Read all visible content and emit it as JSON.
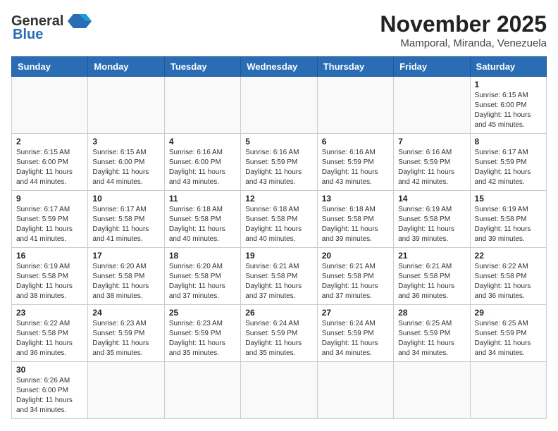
{
  "header": {
    "logo_general": "General",
    "logo_blue": "Blue",
    "month_title": "November 2025",
    "location": "Mamporal, Miranda, Venezuela"
  },
  "days_of_week": [
    "Sunday",
    "Monday",
    "Tuesday",
    "Wednesday",
    "Thursday",
    "Friday",
    "Saturday"
  ],
  "weeks": [
    {
      "days": [
        {
          "number": "",
          "sunrise": "",
          "sunset": "",
          "daylight": "",
          "empty": true
        },
        {
          "number": "",
          "sunrise": "",
          "sunset": "",
          "daylight": "",
          "empty": true
        },
        {
          "number": "",
          "sunrise": "",
          "sunset": "",
          "daylight": "",
          "empty": true
        },
        {
          "number": "",
          "sunrise": "",
          "sunset": "",
          "daylight": "",
          "empty": true
        },
        {
          "number": "",
          "sunrise": "",
          "sunset": "",
          "daylight": "",
          "empty": true
        },
        {
          "number": "",
          "sunrise": "",
          "sunset": "",
          "daylight": "",
          "empty": true
        },
        {
          "number": "1",
          "sunrise": "Sunrise: 6:15 AM",
          "sunset": "Sunset: 6:00 PM",
          "daylight": "Daylight: 11 hours and 45 minutes.",
          "empty": false
        }
      ]
    },
    {
      "days": [
        {
          "number": "2",
          "sunrise": "Sunrise: 6:15 AM",
          "sunset": "Sunset: 6:00 PM",
          "daylight": "Daylight: 11 hours and 44 minutes.",
          "empty": false
        },
        {
          "number": "3",
          "sunrise": "Sunrise: 6:15 AM",
          "sunset": "Sunset: 6:00 PM",
          "daylight": "Daylight: 11 hours and 44 minutes.",
          "empty": false
        },
        {
          "number": "4",
          "sunrise": "Sunrise: 6:16 AM",
          "sunset": "Sunset: 6:00 PM",
          "daylight": "Daylight: 11 hours and 43 minutes.",
          "empty": false
        },
        {
          "number": "5",
          "sunrise": "Sunrise: 6:16 AM",
          "sunset": "Sunset: 5:59 PM",
          "daylight": "Daylight: 11 hours and 43 minutes.",
          "empty": false
        },
        {
          "number": "6",
          "sunrise": "Sunrise: 6:16 AM",
          "sunset": "Sunset: 5:59 PM",
          "daylight": "Daylight: 11 hours and 43 minutes.",
          "empty": false
        },
        {
          "number": "7",
          "sunrise": "Sunrise: 6:16 AM",
          "sunset": "Sunset: 5:59 PM",
          "daylight": "Daylight: 11 hours and 42 minutes.",
          "empty": false
        },
        {
          "number": "8",
          "sunrise": "Sunrise: 6:17 AM",
          "sunset": "Sunset: 5:59 PM",
          "daylight": "Daylight: 11 hours and 42 minutes.",
          "empty": false
        }
      ]
    },
    {
      "days": [
        {
          "number": "9",
          "sunrise": "Sunrise: 6:17 AM",
          "sunset": "Sunset: 5:59 PM",
          "daylight": "Daylight: 11 hours and 41 minutes.",
          "empty": false
        },
        {
          "number": "10",
          "sunrise": "Sunrise: 6:17 AM",
          "sunset": "Sunset: 5:58 PM",
          "daylight": "Daylight: 11 hours and 41 minutes.",
          "empty": false
        },
        {
          "number": "11",
          "sunrise": "Sunrise: 6:18 AM",
          "sunset": "Sunset: 5:58 PM",
          "daylight": "Daylight: 11 hours and 40 minutes.",
          "empty": false
        },
        {
          "number": "12",
          "sunrise": "Sunrise: 6:18 AM",
          "sunset": "Sunset: 5:58 PM",
          "daylight": "Daylight: 11 hours and 40 minutes.",
          "empty": false
        },
        {
          "number": "13",
          "sunrise": "Sunrise: 6:18 AM",
          "sunset": "Sunset: 5:58 PM",
          "daylight": "Daylight: 11 hours and 39 minutes.",
          "empty": false
        },
        {
          "number": "14",
          "sunrise": "Sunrise: 6:19 AM",
          "sunset": "Sunset: 5:58 PM",
          "daylight": "Daylight: 11 hours and 39 minutes.",
          "empty": false
        },
        {
          "number": "15",
          "sunrise": "Sunrise: 6:19 AM",
          "sunset": "Sunset: 5:58 PM",
          "daylight": "Daylight: 11 hours and 39 minutes.",
          "empty": false
        }
      ]
    },
    {
      "days": [
        {
          "number": "16",
          "sunrise": "Sunrise: 6:19 AM",
          "sunset": "Sunset: 5:58 PM",
          "daylight": "Daylight: 11 hours and 38 minutes.",
          "empty": false
        },
        {
          "number": "17",
          "sunrise": "Sunrise: 6:20 AM",
          "sunset": "Sunset: 5:58 PM",
          "daylight": "Daylight: 11 hours and 38 minutes.",
          "empty": false
        },
        {
          "number": "18",
          "sunrise": "Sunrise: 6:20 AM",
          "sunset": "Sunset: 5:58 PM",
          "daylight": "Daylight: 11 hours and 37 minutes.",
          "empty": false
        },
        {
          "number": "19",
          "sunrise": "Sunrise: 6:21 AM",
          "sunset": "Sunset: 5:58 PM",
          "daylight": "Daylight: 11 hours and 37 minutes.",
          "empty": false
        },
        {
          "number": "20",
          "sunrise": "Sunrise: 6:21 AM",
          "sunset": "Sunset: 5:58 PM",
          "daylight": "Daylight: 11 hours and 37 minutes.",
          "empty": false
        },
        {
          "number": "21",
          "sunrise": "Sunrise: 6:21 AM",
          "sunset": "Sunset: 5:58 PM",
          "daylight": "Daylight: 11 hours and 36 minutes.",
          "empty": false
        },
        {
          "number": "22",
          "sunrise": "Sunrise: 6:22 AM",
          "sunset": "Sunset: 5:58 PM",
          "daylight": "Daylight: 11 hours and 36 minutes.",
          "empty": false
        }
      ]
    },
    {
      "days": [
        {
          "number": "23",
          "sunrise": "Sunrise: 6:22 AM",
          "sunset": "Sunset: 5:58 PM",
          "daylight": "Daylight: 11 hours and 36 minutes.",
          "empty": false
        },
        {
          "number": "24",
          "sunrise": "Sunrise: 6:23 AM",
          "sunset": "Sunset: 5:59 PM",
          "daylight": "Daylight: 11 hours and 35 minutes.",
          "empty": false
        },
        {
          "number": "25",
          "sunrise": "Sunrise: 6:23 AM",
          "sunset": "Sunset: 5:59 PM",
          "daylight": "Daylight: 11 hours and 35 minutes.",
          "empty": false
        },
        {
          "number": "26",
          "sunrise": "Sunrise: 6:24 AM",
          "sunset": "Sunset: 5:59 PM",
          "daylight": "Daylight: 11 hours and 35 minutes.",
          "empty": false
        },
        {
          "number": "27",
          "sunrise": "Sunrise: 6:24 AM",
          "sunset": "Sunset: 5:59 PM",
          "daylight": "Daylight: 11 hours and 34 minutes.",
          "empty": false
        },
        {
          "number": "28",
          "sunrise": "Sunrise: 6:25 AM",
          "sunset": "Sunset: 5:59 PM",
          "daylight": "Daylight: 11 hours and 34 minutes.",
          "empty": false
        },
        {
          "number": "29",
          "sunrise": "Sunrise: 6:25 AM",
          "sunset": "Sunset: 5:59 PM",
          "daylight": "Daylight: 11 hours and 34 minutes.",
          "empty": false
        }
      ]
    },
    {
      "days": [
        {
          "number": "30",
          "sunrise": "Sunrise: 6:26 AM",
          "sunset": "Sunset: 6:00 PM",
          "daylight": "Daylight: 11 hours and 34 minutes.",
          "empty": false
        },
        {
          "number": "",
          "sunrise": "",
          "sunset": "",
          "daylight": "",
          "empty": true
        },
        {
          "number": "",
          "sunrise": "",
          "sunset": "",
          "daylight": "",
          "empty": true
        },
        {
          "number": "",
          "sunrise": "",
          "sunset": "",
          "daylight": "",
          "empty": true
        },
        {
          "number": "",
          "sunrise": "",
          "sunset": "",
          "daylight": "",
          "empty": true
        },
        {
          "number": "",
          "sunrise": "",
          "sunset": "",
          "daylight": "",
          "empty": true
        },
        {
          "number": "",
          "sunrise": "",
          "sunset": "",
          "daylight": "",
          "empty": true
        }
      ]
    }
  ]
}
